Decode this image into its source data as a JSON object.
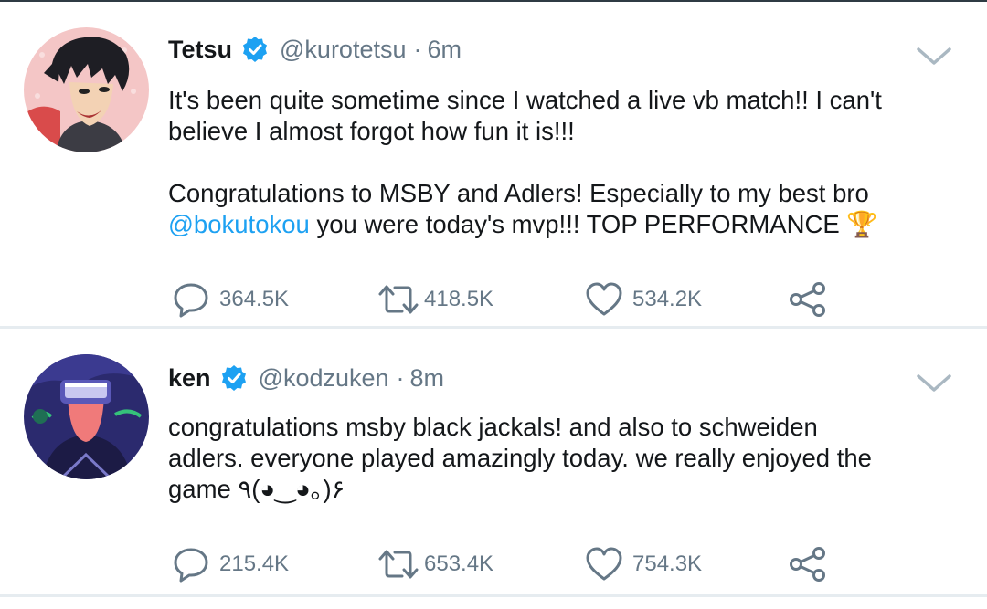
{
  "tweets": [
    {
      "display_name": "Tetsu",
      "handle": "@kurotetsu",
      "separator": "·",
      "time": "6m",
      "verified": true,
      "avatar_icon": "anime-boy-avatar",
      "paragraphs": [
        {
          "text": "It's been quite sometime since I watched a live vb match!! I can't believe I almost forgot how fun it is!!!"
        },
        {
          "mention": "@bokutokou",
          "pre": "Congratulations to MSBY and Adlers! Especially to my best bro ",
          "post": " you were today's mvp!!! TOP PERFORMANCE 🏆"
        }
      ],
      "replies": "364.5K",
      "retweets": "418.5K",
      "likes": "534.2K"
    },
    {
      "display_name": "ken",
      "handle": "@kodzuken",
      "separator": "·",
      "time": "8m",
      "verified": true,
      "avatar_icon": "vr-headset-avatar",
      "paragraphs": [
        {
          "text": "congratulations msby black jackals! and also to schweiden adlers. everyone played amazingly today. we really enjoyed the game ٩(◕‿◕｡)۶"
        }
      ],
      "replies": "215.4K",
      "retweets": "653.4K",
      "likes": "754.3K"
    }
  ],
  "colors": {
    "accent": "#1da1f2",
    "muted": "#657786",
    "text": "#14171a",
    "separator": "#e6ecf0"
  }
}
